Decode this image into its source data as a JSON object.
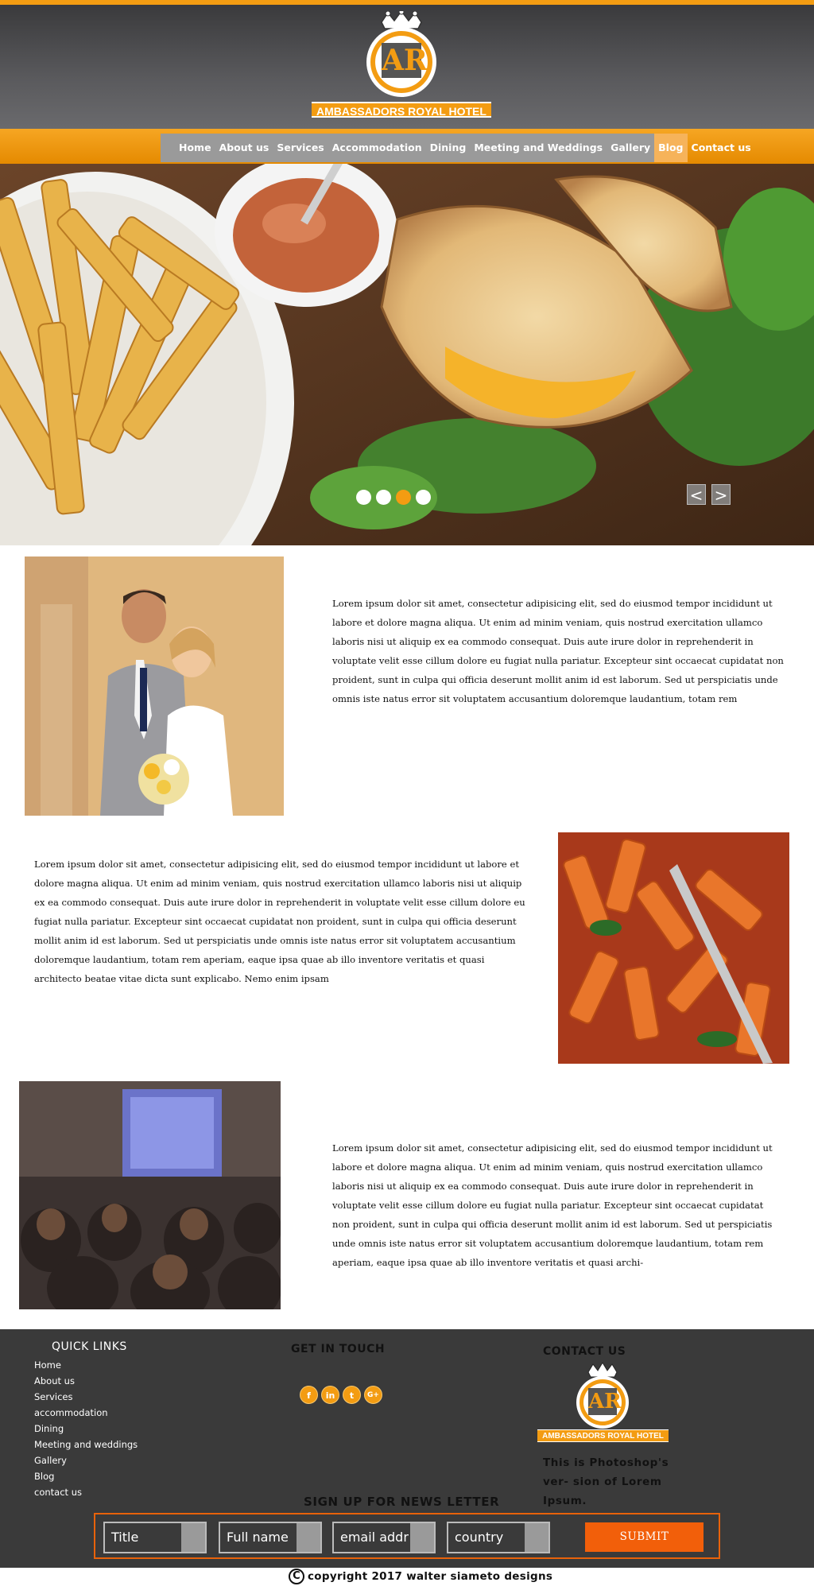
{
  "header": {
    "logo_initials": "AR",
    "hotel_name": "AMBASSADORS ROYAL HOTEL"
  },
  "nav": {
    "items": [
      {
        "label": "Home"
      },
      {
        "label": "About us"
      },
      {
        "label": "Services"
      },
      {
        "label": "Accommodation"
      },
      {
        "label": "Dining"
      },
      {
        "label": "Meeting and Weddings"
      },
      {
        "label": "Gallery"
      },
      {
        "label": "Blog",
        "active": true
      },
      {
        "label": "Contact us"
      }
    ]
  },
  "slider": {
    "image": "fries-and-grilled-sandwich",
    "slide_count": 4,
    "active_slide": 3,
    "prev_label": "<",
    "next_label": ">"
  },
  "sections": [
    {
      "image": "wedding-couple-photo",
      "text": "Lorem ipsum dolor sit amet, consectetur adipisicing elit, sed do eiusmod tempor incididunt ut labore et dolore magna aliqua. Ut enim ad minim veniam, quis nostrud exercitation ullamco laboris nisi ut aliquip ex ea commodo consequat. Duis aute irure dolor in reprehenderit in voluptate velit esse cillum dolore eu fugiat nulla pariatur. Excepteur sint occaecat cupidatat non proident, sunt in culpa qui officia deserunt mollit anim id est laborum. Sed ut perspiciatis unde omnis iste natus error sit voluptatem accusantium doloremque laudantium, totam rem"
    },
    {
      "image": "penne-pasta-photo",
      "text": "Lorem ipsum dolor sit amet, consectetur adipisicing elit, sed do eiusmod tempor incididunt ut labore et dolore magna aliqua. Ut enim ad minim veniam, quis nostrud exercitation ullamco laboris nisi ut aliquip ex ea commodo consequat. Duis aute irure dolor in reprehenderit in voluptate velit esse cillum dolore eu fugiat nulla pariatur. Excepteur sint occaecat cupidatat non proident, sunt in culpa qui officia deserunt mollit anim id est laborum. Sed ut perspiciatis unde omnis iste natus error sit voluptatem accusantium doloremque laudantium, totam rem aperiam, eaque ipsa quae ab illo inventore veritatis et quasi architecto beatae vitae dicta sunt explicabo. Nemo enim ipsam"
    },
    {
      "image": "conference-hall-photo",
      "text": "Lorem ipsum dolor sit amet, consectetur adipisicing elit, sed do eiusmod tempor incididunt ut labore et dolore magna aliqua. Ut enim ad minim veniam, quis nostrud exercitation ullamco laboris nisi ut aliquip ex ea commodo consequat. Duis aute irure dolor in reprehenderit in voluptate velit esse cillum dolore eu fugiat nulla pariatur. Excepteur sint occaecat cupidatat non proident, sunt in culpa qui officia deserunt mollit anim id est laborum. Sed ut perspiciatis unde omnis iste natus error sit voluptatem accusantium doloremque laudantium, totam rem aperiam, eaque ipsa quae ab illo inventore veritatis et quasi archi-"
    }
  ],
  "footer": {
    "quick_links_title": "QUICK LINKS",
    "quick_links": [
      "Home",
      "About us",
      "Services",
      "accommodation",
      "Dining",
      "Meeting and weddings",
      "Gallery",
      "Blog",
      "contact us"
    ],
    "get_in_touch_title": "GET IN TOUCH",
    "socials": [
      {
        "icon": "facebook-icon",
        "glyph": "f"
      },
      {
        "icon": "linkedin-icon",
        "glyph": "in"
      },
      {
        "icon": "twitter-icon",
        "glyph": "t"
      },
      {
        "icon": "google-plus-icon",
        "glyph": "G+"
      }
    ],
    "contact_title": "CONTACT US",
    "logo_initials": "AR",
    "hotel_name": "AMBASSADORS ROYAL HOTEL",
    "contact_text": "This is Photoshop's ver- sion  of Lorem Ipsum.",
    "newsletter_title": "SIGN UP FOR NEWS LETTER",
    "fields": {
      "title": "Title",
      "full_name": "Full name",
      "email": "email addr",
      "country": "country"
    },
    "submit_label": "SUBMIT"
  },
  "copyright": {
    "symbol": "C",
    "text": "copyright 2017  walter siameto designs"
  },
  "colors": {
    "accent": "#f39c12",
    "submit": "#f25f0a",
    "footer_bg": "#3a3a3a",
    "header_bg": "#4a4a4c"
  }
}
